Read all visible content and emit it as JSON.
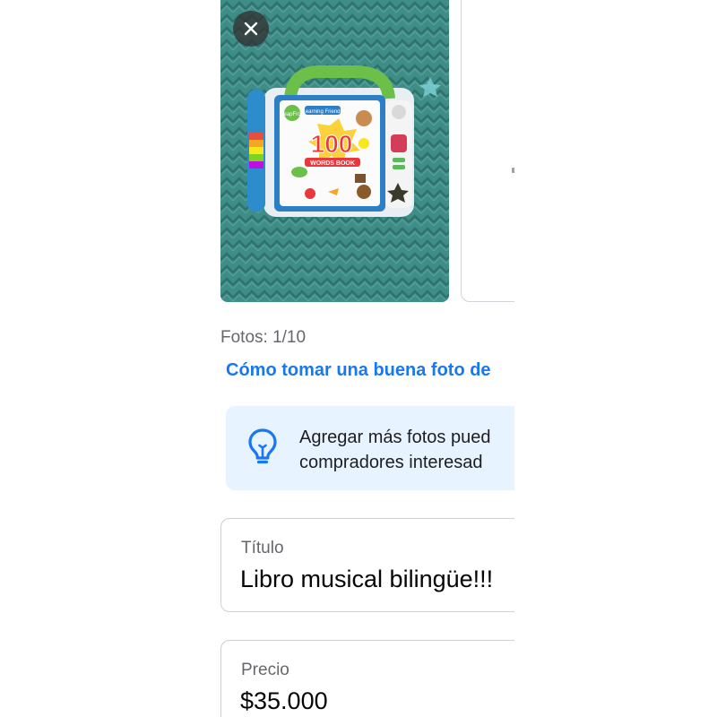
{
  "photos": {
    "count_label": "Fotos: 1/10",
    "tips_link": "Cómo tomar una buena foto de",
    "remove_icon": "close-icon",
    "book": {
      "brand_badge": "LeapFrog",
      "series_label": "Learning Friends",
      "big_number": "100",
      "subtitle": "WORDS BOOK"
    }
  },
  "tip": {
    "icon": "lightbulb-icon",
    "line1": "Agregar más fotos pued",
    "line2": "compradores interesad"
  },
  "form": {
    "title_label": "Título",
    "title_value": "Libro musical bilingüe!!!",
    "price_label": "Precio",
    "price_value": "$35.000"
  },
  "colors": {
    "link": "#1877f2",
    "tip_background": "#e7f3ff",
    "border": "#ced0d4",
    "secondary_text": "#65676b"
  }
}
